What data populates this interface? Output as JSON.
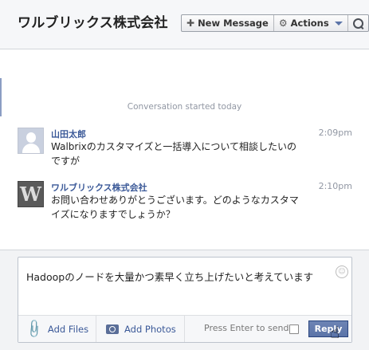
{
  "header": {
    "title": "ワルブリックス株式会社",
    "new_message_label": "New Message",
    "actions_label": "Actions"
  },
  "conversation": {
    "started_label": "Conversation started today",
    "messages": [
      {
        "sender": "山田太郎",
        "time": "2:09pm",
        "text": "Walbrixのカスタマイズと一括導入について相談したいのですが",
        "avatar": "default-person"
      },
      {
        "sender": "ワルブリックス株式会社",
        "time": "2:10pm",
        "text": "お問い合わせありがとうございます。どのようなカスタマイズになりますでしょうか？",
        "avatar": "W"
      }
    ]
  },
  "composer": {
    "value": "Hadoopのノードを大量かつ素早く立ち上げたいと考えています",
    "add_files_label": "Add Files",
    "add_photos_label": "Add Photos",
    "press_enter_label": "Press Enter to send",
    "reply_label": "Reply"
  }
}
